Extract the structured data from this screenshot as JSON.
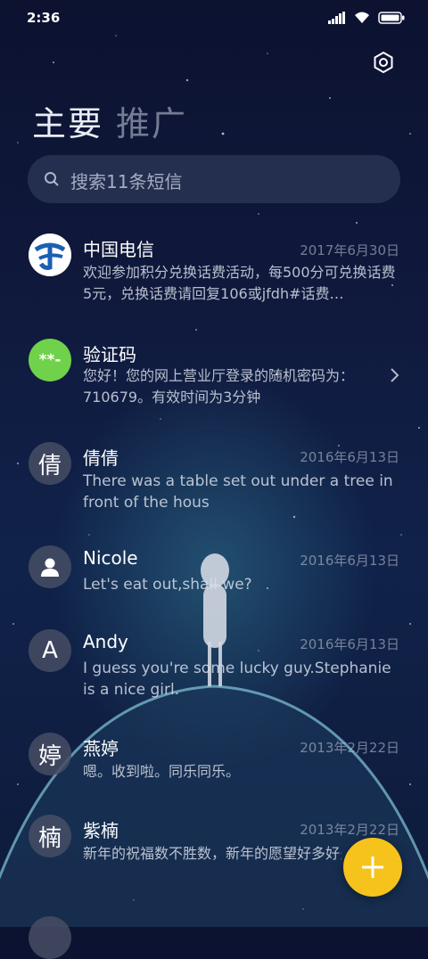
{
  "status_bar": {
    "time": "2:36"
  },
  "tabs": [
    {
      "label": "主要",
      "active": true
    },
    {
      "label": "推广",
      "active": false
    }
  ],
  "search": {
    "placeholder": "搜索11条短信"
  },
  "messages": [
    {
      "name": "中国电信",
      "date": "2017年6月30日",
      "preview": "欢迎参加积分兑换话费活动，每500分可兑换话费5元，兑换话费请回复106或jfdh#话费…",
      "avatar": "china-telecom-logo"
    },
    {
      "name": "验证码",
      "date": "",
      "preview": "您好！您的网上营业厅登录的随机密码为：710679。有效时间为3分钟",
      "avatar_text": "**-"
    },
    {
      "name": "倩倩",
      "date": "2016年6月13日",
      "preview": "There was a table set out under a tree in front of the hous",
      "avatar_text": "倩"
    },
    {
      "name": "Nicole",
      "date": "2016年6月13日",
      "preview": "Let's eat out,shall we?",
      "avatar": "person-icon"
    },
    {
      "name": "Andy",
      "date": "2016年6月13日",
      "preview": "I guess you're some lucky guy.Stephanie is a nice girl.",
      "avatar_text": "A"
    },
    {
      "name": "燕婷",
      "date": "2013年2月22日",
      "preview": "嗯。收到啦。同乐同乐。",
      "avatar_text": "婷"
    },
    {
      "name": "紫楠",
      "date": "2013年2月22日",
      "preview": "新年的祝福数不胜数，新年的愿望好多好多，新年的问候依旧美好，在这个温馨的时刻…",
      "avatar_text": "楠"
    }
  ],
  "colors": {
    "accent": "#f6c21c",
    "verify_green": "#6fd24a",
    "telecom_blue": "#1a5fb4"
  }
}
